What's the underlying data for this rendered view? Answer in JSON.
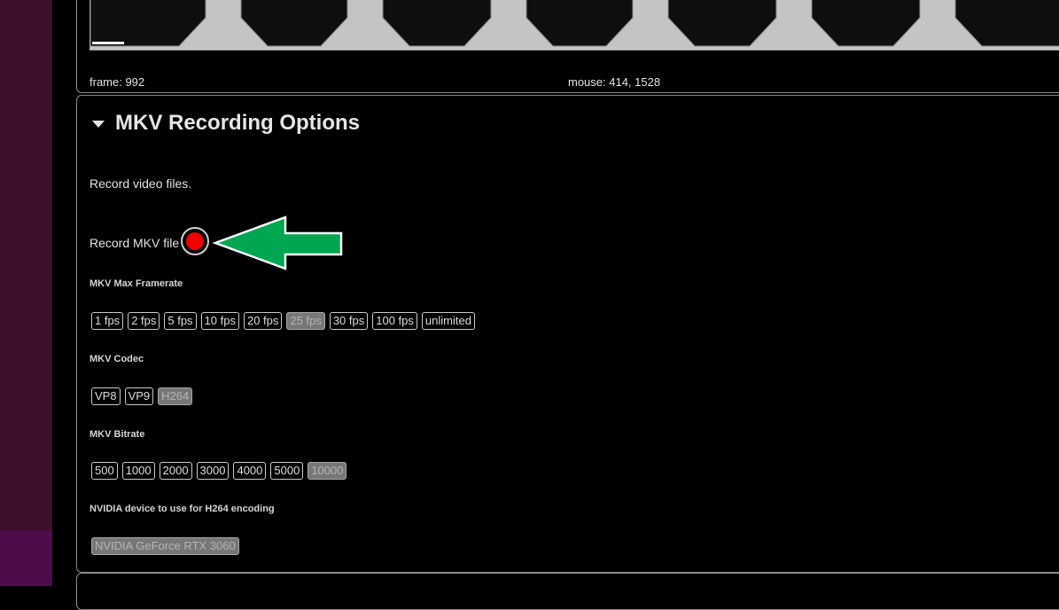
{
  "status": {
    "frame": "frame: 992",
    "mouse": "mouse: 414, 1528"
  },
  "section": {
    "title": "MKV Recording Options",
    "description": "Record video files."
  },
  "record": {
    "label": "Record MKV file",
    "button_color": "#f20000",
    "annotation_arrow_color": "#00a651"
  },
  "framerate": {
    "label": "MKV Max Framerate",
    "options": [
      "1 fps",
      "2 fps",
      "5 fps",
      "10 fps",
      "20 fps",
      "25 fps",
      "30 fps",
      "100 fps",
      "unlimited"
    ],
    "selected": "25 fps"
  },
  "codec": {
    "label": "MKV Codec",
    "options": [
      "VP8",
      "VP9",
      "H264"
    ],
    "selected": "H264"
  },
  "bitrate": {
    "label": "MKV Bitrate",
    "options": [
      "500",
      "1000",
      "2000",
      "3000",
      "4000",
      "5000",
      "10000"
    ],
    "selected": "10000"
  },
  "nvidia": {
    "label": "NVIDIA device to use for H264 encoding",
    "options": [
      "NVIDIA GeForce RTX 3060"
    ],
    "selected": "NVIDIA GeForce RTX 3060"
  }
}
